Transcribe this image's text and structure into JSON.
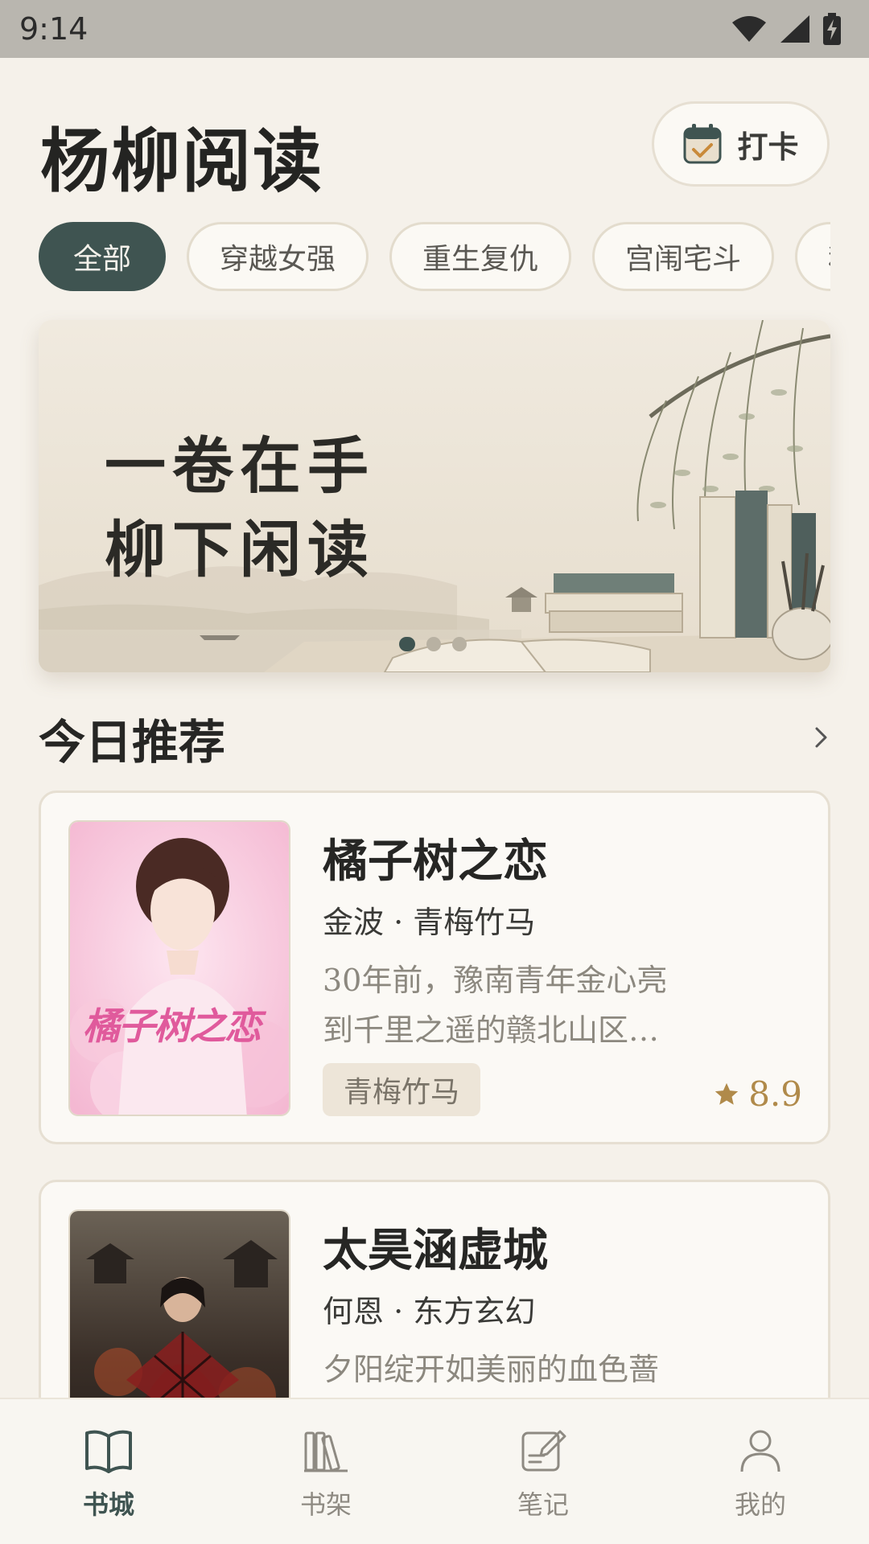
{
  "status_bar": {
    "time": "9:14"
  },
  "header": {
    "app_title": "杨柳阅读",
    "checkin_label": "打卡"
  },
  "categories": {
    "items": [
      "全部",
      "穿越女强",
      "重生复仇",
      "宫闱宅斗",
      "种"
    ],
    "active_index": 0
  },
  "banner": {
    "line1": "一卷在手",
    "line2": "柳下闲读",
    "page_count": 3,
    "active_page": 0
  },
  "recommend": {
    "title": "今日推荐",
    "more_icon": "chevron-right-icon"
  },
  "books": [
    {
      "title": "橘子树之恋",
      "meta": "金波 · 青梅竹马",
      "desc_line1": "30年前，豫南青年金心亮",
      "desc_line2": "到千里之遥的赣北山区…",
      "tag": "青梅竹马",
      "rating": "8.9",
      "cover_text": "橘子树之恋"
    },
    {
      "title": "太昊涵虚城",
      "meta": "何恩 · 东方玄幻",
      "desc_line1": "夕阳绽开如美丽的血色蔷"
    }
  ],
  "bottom_nav": [
    {
      "label": "书城",
      "icon": "open-book-icon",
      "active": true
    },
    {
      "label": "书架",
      "icon": "bookshelf-icon",
      "active": false
    },
    {
      "label": "笔记",
      "icon": "note-edit-icon",
      "active": false
    },
    {
      "label": "我的",
      "icon": "user-icon",
      "active": false
    }
  ],
  "colors": {
    "background": "#f5f1ea",
    "accent": "#3f5451",
    "rating": "#b08a4a",
    "tag_bg": "#ede5d8"
  }
}
